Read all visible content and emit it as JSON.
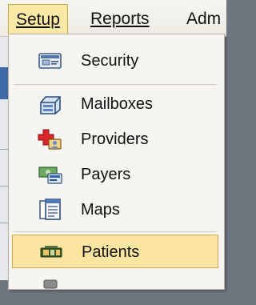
{
  "menubar": {
    "items": [
      {
        "label": "Setup",
        "state": "open"
      },
      {
        "label": "Reports"
      },
      {
        "label": "Adm"
      }
    ]
  },
  "dropdown": {
    "items": [
      {
        "label": "Security",
        "icon": "security-id-card-icon"
      },
      {
        "label": "Mailboxes",
        "icon": "mailbox-tray-icon"
      },
      {
        "label": "Providers",
        "icon": "providers-cross-icon"
      },
      {
        "label": "Payers",
        "icon": "payers-money-icon"
      },
      {
        "label": "Maps",
        "icon": "maps-document-icon"
      },
      {
        "label": "Patients",
        "icon": "patients-card-icon",
        "selected": true
      }
    ]
  },
  "colors": {
    "selection_fill": "#fbe5a0",
    "selection_border": "#d0a94f",
    "menu_bg": "#f6f5f1"
  }
}
